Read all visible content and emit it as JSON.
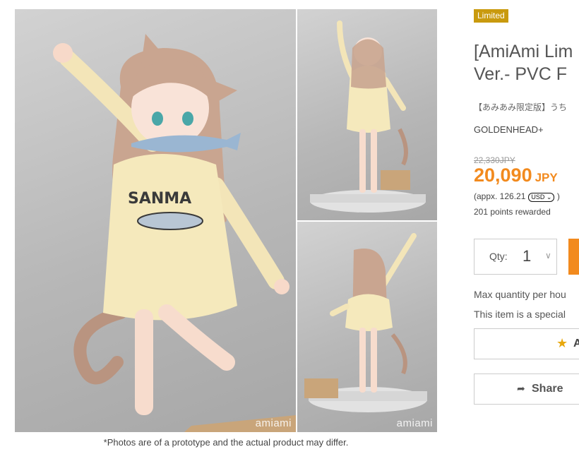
{
  "gallery": {
    "watermark": "amiami",
    "caption": "*Photos are of a prototype and the actual product may differ.",
    "shirt_text": "SANMA"
  },
  "product": {
    "badge": "Limited",
    "title_line1": "[AmiAmi Lim",
    "title_line2": "Ver.- PVC F",
    "jp_title": "【あみあみ限定版】うち",
    "maker": "GOLDENHEAD+",
    "old_price": "22,330JPY",
    "price_value": "20,090",
    "price_currency": "JPY",
    "approx_text": "(appx. 126.21",
    "currency_select": "USD",
    "approx_close": ")",
    "points": "201 points rewarded"
  },
  "purchase": {
    "qty_label": "Qty:",
    "qty_value": "1",
    "max_qty_text": "Max quantity per hou",
    "special_text": "This item is a special",
    "wishlist_label_visible": "A",
    "share_label": "Share"
  },
  "icons": {
    "qty_dropdown": "chevron-down-icon",
    "wishlist": "star-icon",
    "share": "share-icon",
    "select_arrow": "chevron-down-icon"
  },
  "colors": {
    "badge": "#c99a0e",
    "price": "#f28a1e",
    "cart_button": "#f28a1e",
    "star": "#e8a80e"
  }
}
